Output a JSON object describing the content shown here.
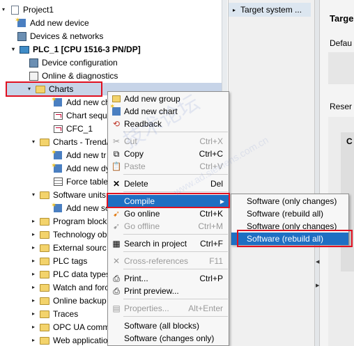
{
  "tree": {
    "items": [
      {
        "label": "Project1",
        "icon": "project-icon",
        "arrow": "▾"
      },
      {
        "label": "Add new device",
        "icon": "add-device-icon",
        "arrow": ""
      },
      {
        "label": "Devices & networks",
        "icon": "network-icon",
        "arrow": ""
      },
      {
        "label": "PLC_1 [CPU 1516-3 PN/DP]",
        "icon": "plc-icon",
        "arrow": "▾"
      },
      {
        "label": "Device configuration",
        "icon": "device-config-icon",
        "arrow": ""
      },
      {
        "label": "Online & diagnostics",
        "icon": "diagnostics-icon",
        "arrow": ""
      },
      {
        "label": "Charts",
        "icon": "charts-folder-icon",
        "arrow": "▾"
      },
      {
        "label": "Add new ch",
        "icon": "add-chart-icon",
        "arrow": ""
      },
      {
        "label": "Chart sequ",
        "icon": "chart-sequence-icon",
        "arrow": ""
      },
      {
        "label": "CFC_1",
        "icon": "cfc-icon",
        "arrow": ""
      },
      {
        "label": "Charts - Trend/",
        "icon": "folder-icon",
        "arrow": "▾"
      },
      {
        "label": "Add new tr",
        "icon": "add-trend-icon",
        "arrow": ""
      },
      {
        "label": "Add new dy",
        "icon": "add-dynamic-icon",
        "arrow": ""
      },
      {
        "label": "Force table",
        "icon": "force-table-icon",
        "arrow": ""
      },
      {
        "label": "Software units",
        "icon": "folder-icon",
        "arrow": "▾"
      },
      {
        "label": "Add new so",
        "icon": "add-software-unit-icon",
        "arrow": ""
      },
      {
        "label": "Program block",
        "icon": "folder-icon",
        "arrow": "▸"
      },
      {
        "label": "Technology ob",
        "icon": "folder-icon",
        "arrow": "▸"
      },
      {
        "label": "External sourc",
        "icon": "folder-icon",
        "arrow": "▸"
      },
      {
        "label": "PLC tags",
        "icon": "folder-icon",
        "arrow": "▸"
      },
      {
        "label": "PLC data types",
        "icon": "folder-icon",
        "arrow": "▸"
      },
      {
        "label": "Watch and forc",
        "icon": "folder-icon",
        "arrow": "▸"
      },
      {
        "label": "Online backup",
        "icon": "folder-icon",
        "arrow": "▸"
      },
      {
        "label": "Traces",
        "icon": "folder-icon",
        "arrow": "▸"
      },
      {
        "label": "OPC UA comm",
        "icon": "folder-icon",
        "arrow": "▸"
      },
      {
        "label": "Web applicatio",
        "icon": "folder-icon",
        "arrow": "▸"
      }
    ]
  },
  "mid_pane": {
    "header": "Target system ..."
  },
  "right_pane": {
    "title": "Targe",
    "label_default": "Defau",
    "label_reserved": "Reser",
    "box_label": "C"
  },
  "context_menu": {
    "items": [
      {
        "label": "Add new group",
        "shortcut": "",
        "icon": "folder-icon",
        "disabled": false
      },
      {
        "label": "Add new chart",
        "shortcut": "",
        "icon": "add-chart-icon",
        "disabled": false
      },
      {
        "label": "Readback",
        "shortcut": "",
        "icon": "readback-icon",
        "disabled": false
      },
      {
        "label": "Cut",
        "shortcut": "Ctrl+X",
        "icon": "cut-icon",
        "disabled": true
      },
      {
        "label": "Copy",
        "shortcut": "Ctrl+C",
        "icon": "copy-icon",
        "disabled": false
      },
      {
        "label": "Paste",
        "shortcut": "Ctrl+V",
        "icon": "paste-icon",
        "disabled": true
      },
      {
        "label": "Delete",
        "shortcut": "Del",
        "icon": "delete-icon",
        "disabled": false
      },
      {
        "label": "Compile",
        "shortcut": "",
        "icon": "",
        "disabled": false,
        "submenu": true
      },
      {
        "label": "Go online",
        "shortcut": "Ctrl+K",
        "icon": "go-online-icon",
        "disabled": false
      },
      {
        "label": "Go offline",
        "shortcut": "Ctrl+M",
        "icon": "go-offline-icon",
        "disabled": true
      },
      {
        "label": "Search in project",
        "shortcut": "Ctrl+F",
        "icon": "search-icon",
        "disabled": false
      },
      {
        "label": "Cross-references",
        "shortcut": "F11",
        "icon": "cross-references-icon",
        "disabled": true
      },
      {
        "label": "Print...",
        "shortcut": "Ctrl+P",
        "icon": "print-icon",
        "disabled": false
      },
      {
        "label": "Print preview...",
        "shortcut": "",
        "icon": "print-preview-icon",
        "disabled": false
      },
      {
        "label": "Properties...",
        "shortcut": "Alt+Enter",
        "icon": "properties-icon",
        "disabled": true
      },
      {
        "label": "Software (all blocks)",
        "shortcut": "",
        "icon": "",
        "disabled": false
      },
      {
        "label": "Software (changes only)",
        "shortcut": "",
        "icon": "",
        "disabled": false
      }
    ]
  },
  "submenu": {
    "items": [
      {
        "label": "Software (only changes)"
      },
      {
        "label": "Software (rebuild all)"
      },
      {
        "label": "Software (only changes)"
      },
      {
        "label": "Software (rebuild all)"
      }
    ]
  },
  "colors": {
    "highlight": "#1e6fc3",
    "annotation_red": "#e01020",
    "selection": "#c7d4e8"
  }
}
